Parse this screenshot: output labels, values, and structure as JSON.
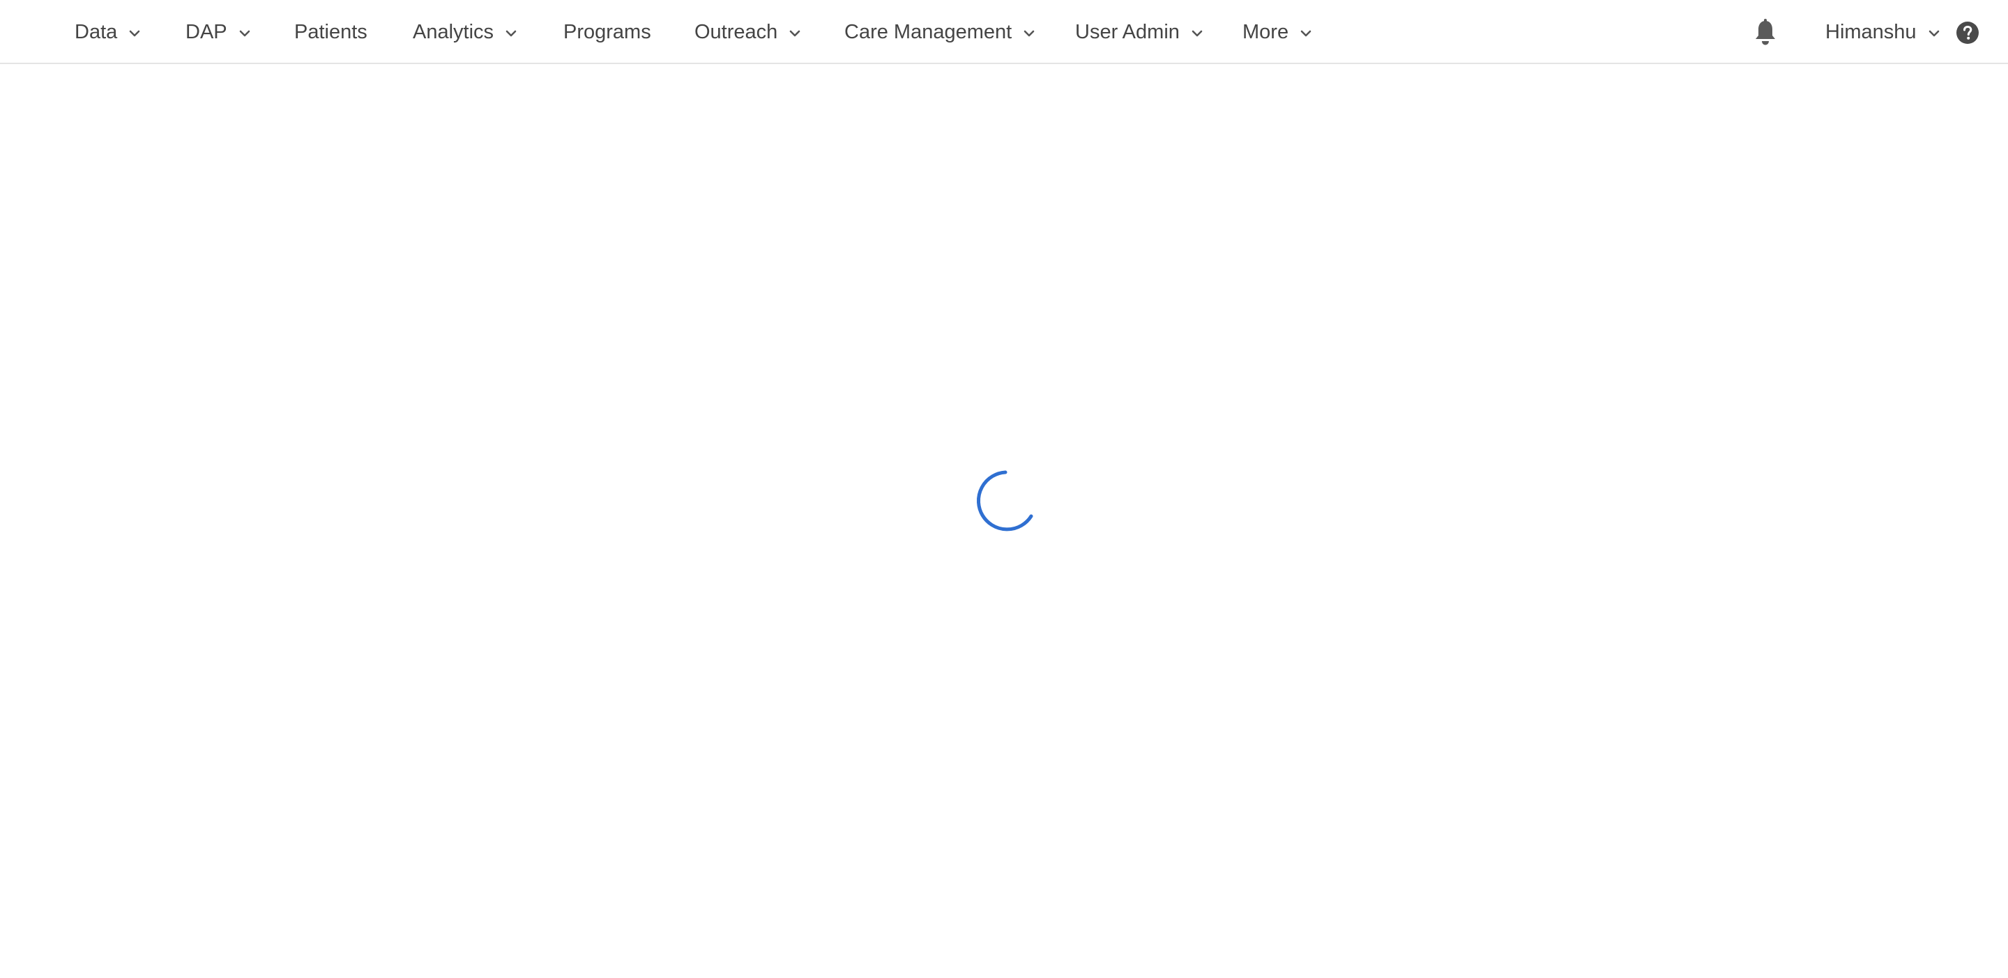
{
  "nav": {
    "items": [
      {
        "label": "Data",
        "has_dropdown": true
      },
      {
        "label": "DAP",
        "has_dropdown": true
      },
      {
        "label": "Patients",
        "has_dropdown": false
      },
      {
        "label": "Analytics",
        "has_dropdown": true
      },
      {
        "label": "Programs",
        "has_dropdown": false
      },
      {
        "label": "Outreach",
        "has_dropdown": true
      },
      {
        "label": "Care Management",
        "has_dropdown": true
      },
      {
        "label": "User Admin",
        "has_dropdown": true
      },
      {
        "label": "More",
        "has_dropdown": true
      }
    ]
  },
  "header_right": {
    "notifications_icon": "bell-icon",
    "user_name": "Himanshu",
    "help_icon": "question-circle-icon"
  },
  "main": {
    "loading_indicator": "spinner",
    "accent_color": "#2f6fd1"
  },
  "colors": {
    "nav_text": "#444444",
    "icon_gray": "#555555",
    "divider": "#e4e4e4"
  }
}
